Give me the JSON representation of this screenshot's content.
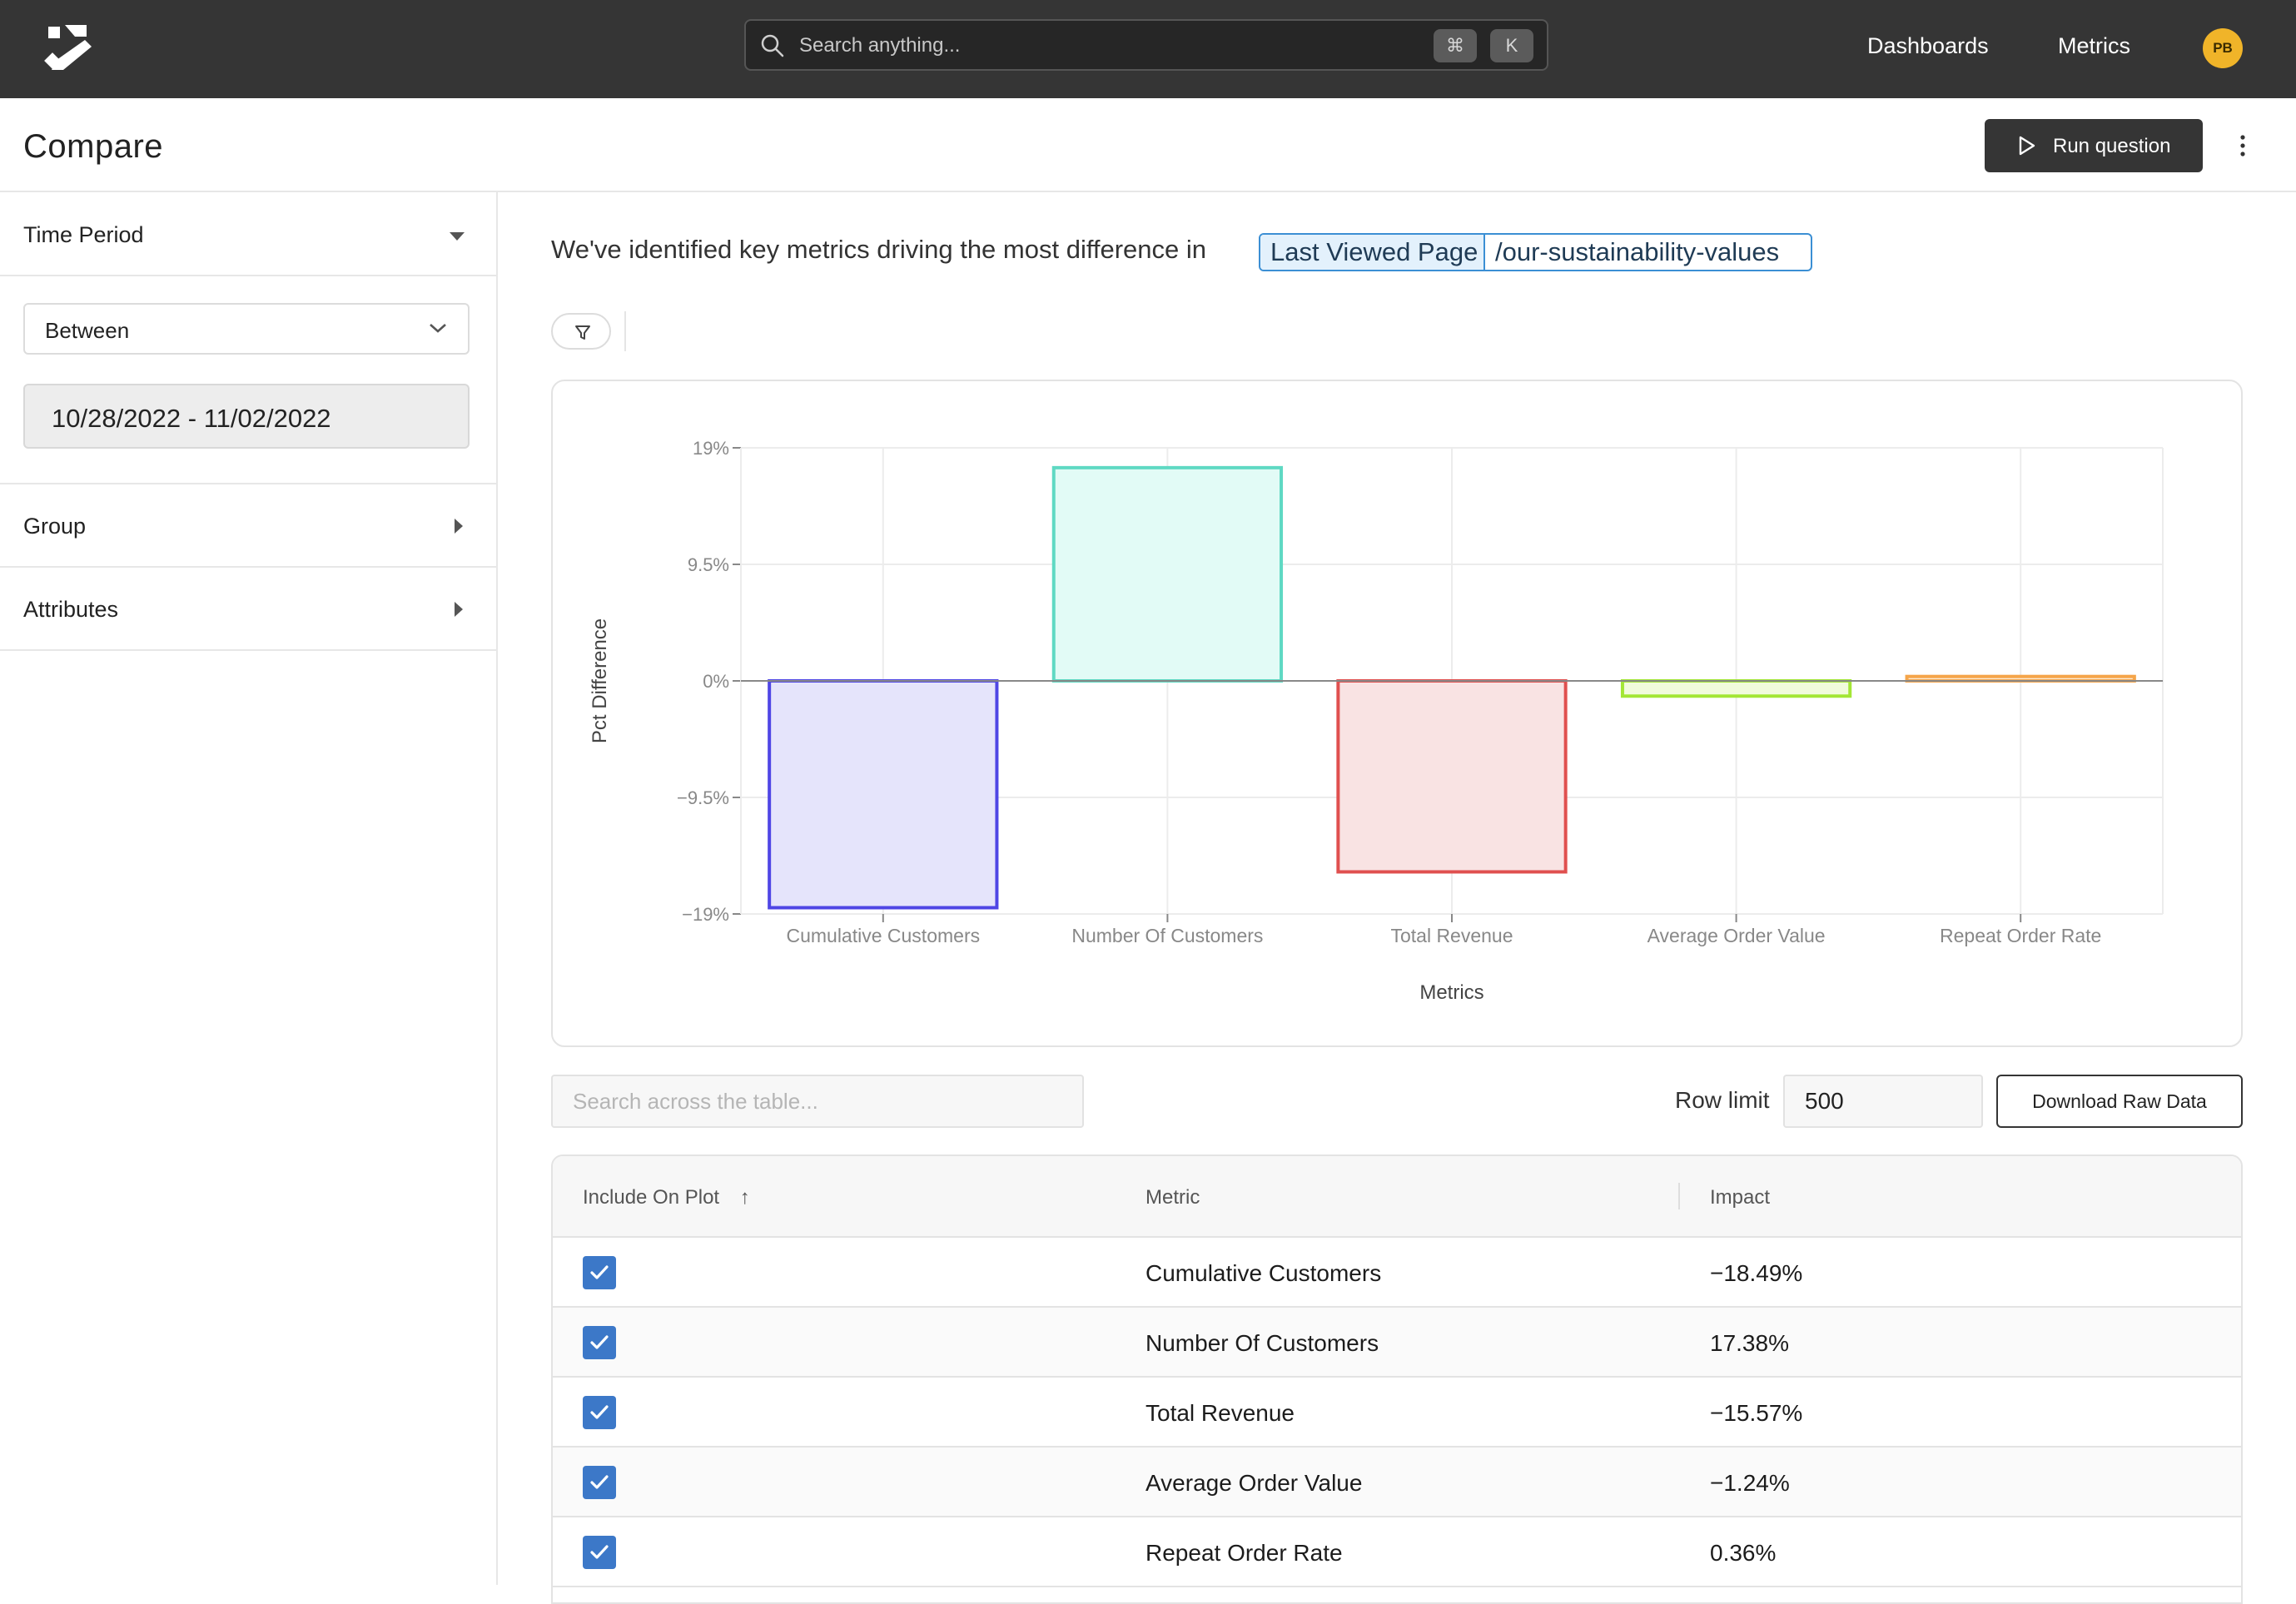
{
  "topbar": {
    "search_placeholder": "Search anything...",
    "shortcut_keys": [
      "⌘",
      "K"
    ],
    "nav": [
      "Dashboards",
      "Metrics"
    ],
    "avatar_initials": "PB",
    "avatar_color": "#f0b429"
  },
  "header": {
    "title": "Compare",
    "run_label": "Run question"
  },
  "sidebar": {
    "time_period_label": "Time Period",
    "range_mode": "Between",
    "date_range": "10/28/2022 - 11/02/2022",
    "group_label": "Group",
    "attributes_label": "Attributes"
  },
  "main": {
    "headline": "We've identified key metrics driving the most difference in",
    "pill_key": "Last Viewed Page",
    "pill_value": "/our-sustainability-values"
  },
  "table_toolbar": {
    "search_placeholder": "Search across the table...",
    "row_limit_label": "Row limit",
    "row_limit_value": "500",
    "download_label": "Download Raw Data"
  },
  "table": {
    "columns": [
      "Include On Plot",
      "Metric",
      "Impact"
    ],
    "sort_indicator": "↑",
    "rows": [
      {
        "included": true,
        "metric": "Cumulative Customers",
        "impact": "−18.49%"
      },
      {
        "included": true,
        "metric": "Number Of Customers",
        "impact": "17.38%"
      },
      {
        "included": true,
        "metric": "Total Revenue",
        "impact": "−15.57%"
      },
      {
        "included": true,
        "metric": "Average Order Value",
        "impact": "−1.24%"
      },
      {
        "included": true,
        "metric": "Repeat Order Rate",
        "impact": "0.36%"
      }
    ]
  },
  "chart_data": {
    "type": "bar",
    "categories": [
      "Cumulative Customers",
      "Number Of Customers",
      "Total Revenue",
      "Average Order Value",
      "Repeat Order Rate"
    ],
    "values": [
      -18.49,
      17.38,
      -15.57,
      -1.24,
      0.36
    ],
    "xlabel": "Metrics",
    "ylabel": "Pct Difference",
    "ylim": [
      -19,
      19
    ],
    "yticks": [
      19,
      9.5,
      0,
      -9.5,
      -19
    ],
    "ytick_labels": [
      "19%",
      "9.5%",
      "0%",
      "−9.5%",
      "−19%"
    ],
    "grid": true,
    "colors": [
      {
        "stroke": "#4f46e5",
        "fill": "#e5e4fb"
      },
      {
        "stroke": "#5fd9c3",
        "fill": "#e2fbf6"
      },
      {
        "stroke": "#e0504f",
        "fill": "#f9e3e3"
      },
      {
        "stroke": "#a3e635",
        "fill": "#f1fbdc"
      },
      {
        "stroke": "#f5a54a",
        "fill": "#fdecd6"
      }
    ]
  }
}
